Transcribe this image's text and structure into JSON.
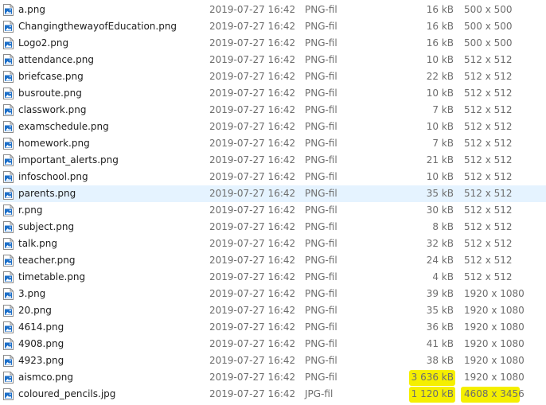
{
  "files": [
    {
      "name": "a.png",
      "date": "2019-07-27 16:42",
      "type": "PNG-fil",
      "size": "16 kB",
      "dims": "500 x 500",
      "icon": "image-file-icon"
    },
    {
      "name": "ChangingthewayofEducation.png",
      "date": "2019-07-27 16:42",
      "type": "PNG-fil",
      "size": "16 kB",
      "dims": "500 x 500",
      "icon": "image-file-icon"
    },
    {
      "name": "Logo2.png",
      "date": "2019-07-27 16:42",
      "type": "PNG-fil",
      "size": "16 kB",
      "dims": "500 x 500",
      "icon": "image-file-icon"
    },
    {
      "name": "attendance.png",
      "date": "2019-07-27 16:42",
      "type": "PNG-fil",
      "size": "10 kB",
      "dims": "512 x 512",
      "icon": "image-file-icon"
    },
    {
      "name": "briefcase.png",
      "date": "2019-07-27 16:42",
      "type": "PNG-fil",
      "size": "22 kB",
      "dims": "512 x 512",
      "icon": "image-file-icon"
    },
    {
      "name": "busroute.png",
      "date": "2019-07-27 16:42",
      "type": "PNG-fil",
      "size": "10 kB",
      "dims": "512 x 512",
      "icon": "image-file-icon"
    },
    {
      "name": "classwork.png",
      "date": "2019-07-27 16:42",
      "type": "PNG-fil",
      "size": "7 kB",
      "dims": "512 x 512",
      "icon": "image-file-icon"
    },
    {
      "name": "examschedule.png",
      "date": "2019-07-27 16:42",
      "type": "PNG-fil",
      "size": "10 kB",
      "dims": "512 x 512",
      "icon": "image-file-icon"
    },
    {
      "name": "homework.png",
      "date": "2019-07-27 16:42",
      "type": "PNG-fil",
      "size": "7 kB",
      "dims": "512 x 512",
      "icon": "image-file-icon"
    },
    {
      "name": "important_alerts.png",
      "date": "2019-07-27 16:42",
      "type": "PNG-fil",
      "size": "21 kB",
      "dims": "512 x 512",
      "icon": "image-file-icon"
    },
    {
      "name": "infoschool.png",
      "date": "2019-07-27 16:42",
      "type": "PNG-fil",
      "size": "10 kB",
      "dims": "512 x 512",
      "icon": "image-file-icon"
    },
    {
      "name": "parents.png",
      "date": "2019-07-27 16:42",
      "type": "PNG-fil",
      "size": "35 kB",
      "dims": "512 x 512",
      "icon": "image-file-icon",
      "selected": true
    },
    {
      "name": "r.png",
      "date": "2019-07-27 16:42",
      "type": "PNG-fil",
      "size": "30 kB",
      "dims": "512 x 512",
      "icon": "image-file-icon"
    },
    {
      "name": "subject.png",
      "date": "2019-07-27 16:42",
      "type": "PNG-fil",
      "size": "8 kB",
      "dims": "512 x 512",
      "icon": "image-file-icon"
    },
    {
      "name": "talk.png",
      "date": "2019-07-27 16:42",
      "type": "PNG-fil",
      "size": "32 kB",
      "dims": "512 x 512",
      "icon": "image-file-icon"
    },
    {
      "name": "teacher.png",
      "date": "2019-07-27 16:42",
      "type": "PNG-fil",
      "size": "24 kB",
      "dims": "512 x 512",
      "icon": "image-file-icon"
    },
    {
      "name": "timetable.png",
      "date": "2019-07-27 16:42",
      "type": "PNG-fil",
      "size": "4 kB",
      "dims": "512 x 512",
      "icon": "image-file-icon"
    },
    {
      "name": "3.png",
      "date": "2019-07-27 16:42",
      "type": "PNG-fil",
      "size": "39 kB",
      "dims": "1920 x 1080",
      "icon": "image-file-icon"
    },
    {
      "name": "20.png",
      "date": "2019-07-27 16:42",
      "type": "PNG-fil",
      "size": "35 kB",
      "dims": "1920 x 1080",
      "icon": "image-file-icon"
    },
    {
      "name": "4614.png",
      "date": "2019-07-27 16:42",
      "type": "PNG-fil",
      "size": "36 kB",
      "dims": "1920 x 1080",
      "icon": "image-file-icon"
    },
    {
      "name": "4908.png",
      "date": "2019-07-27 16:42",
      "type": "PNG-fil",
      "size": "41 kB",
      "dims": "1920 x 1080",
      "icon": "image-file-icon"
    },
    {
      "name": "4923.png",
      "date": "2019-07-27 16:42",
      "type": "PNG-fil",
      "size": "38 kB",
      "dims": "1920 x 1080",
      "icon": "image-file-icon"
    },
    {
      "name": "aismco.png",
      "date": "2019-07-27 16:42",
      "type": "PNG-fil",
      "size": "3 636 kB",
      "dims": "1920 x 1080",
      "icon": "image-file-icon",
      "highlight_size": true
    },
    {
      "name": "coloured_pencils.jpg",
      "date": "2019-07-27 16:42",
      "type": "JPG-fil",
      "size": "1 120 kB",
      "dims": "4608 x 3456",
      "icon": "image-file-icon",
      "highlight_size": true,
      "highlight_dims": true
    }
  ],
  "colors": {
    "selected_row": "#e5f3ff",
    "highlighter": "#f5ef00",
    "icon_blue": "#1c6fc9",
    "secondary_text": "#6d6d6d"
  }
}
